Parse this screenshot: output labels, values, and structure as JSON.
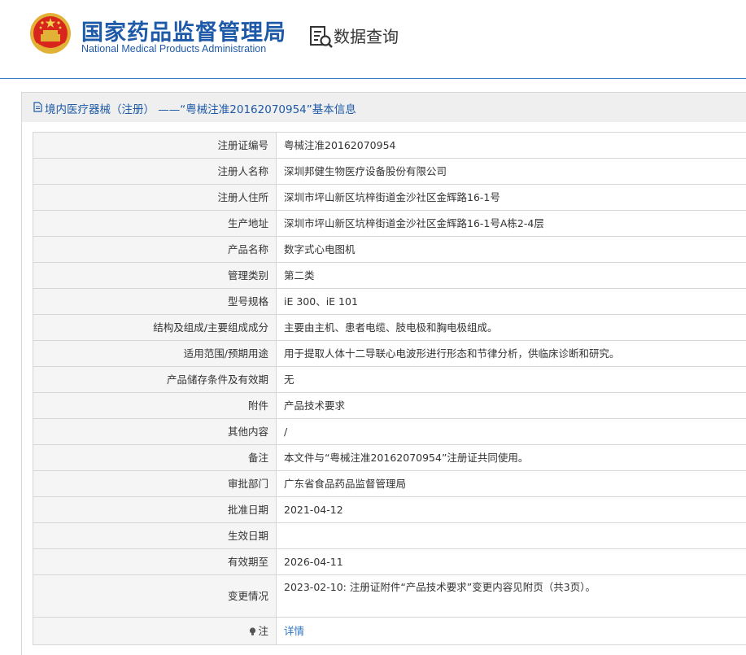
{
  "header": {
    "brand_cn": "国家药品监督管理局",
    "brand_en": "National Medical Products Administration",
    "query_label": "数据查询"
  },
  "panel": {
    "title": "境内医疗器械（注册） ——“粤械注准20162070954”基本信息"
  },
  "rows": [
    {
      "label": "注册证编号",
      "value": "粤械注准20162070954"
    },
    {
      "label": "注册人名称",
      "value": "深圳邦健生物医疗设备股份有限公司"
    },
    {
      "label": "注册人住所",
      "value": "深圳市坪山新区坑梓街道金沙社区金辉路16-1号"
    },
    {
      "label": "生产地址",
      "value": "深圳市坪山新区坑梓街道金沙社区金辉路16-1号A栋2-4层"
    },
    {
      "label": "产品名称",
      "value": "数字式心电图机"
    },
    {
      "label": "管理类别",
      "value": "第二类"
    },
    {
      "label": "型号规格",
      "value": "iE 300、iE 101"
    },
    {
      "label": "结构及组成/主要组成成分",
      "value": "主要由主机、患者电缆、肢电极和胸电极组成。"
    },
    {
      "label": "适用范围/预期用途",
      "value": "用于提取人体十二导联心电波形进行形态和节律分析，供临床诊断和研究。"
    },
    {
      "label": "产品储存条件及有效期",
      "value": "无"
    },
    {
      "label": "附件",
      "value": "产品技术要求"
    },
    {
      "label": "其他内容",
      "value": "/"
    },
    {
      "label": "备注",
      "value": "本文件与“粤械注准20162070954”注册证共同使用。"
    },
    {
      "label": "审批部门",
      "value": "广东省食品药品监督管理局"
    },
    {
      "label": "批准日期",
      "value": "2021-04-12"
    },
    {
      "label": "生效日期",
      "value": ""
    },
    {
      "label": "有效期至",
      "value": "2026-04-11"
    },
    {
      "label": "变更情况",
      "value": "2023-02-10: 注册证附件“产品技术要求”变更内容见附页（共3页）。"
    }
  ],
  "note": {
    "label": "注",
    "link_label": "详情"
  },
  "colors": {
    "brand_blue": "#1e5aa8",
    "link_blue": "#2f75c0",
    "label_bg": "#f5f5f5",
    "border": "#d6d6d6"
  }
}
